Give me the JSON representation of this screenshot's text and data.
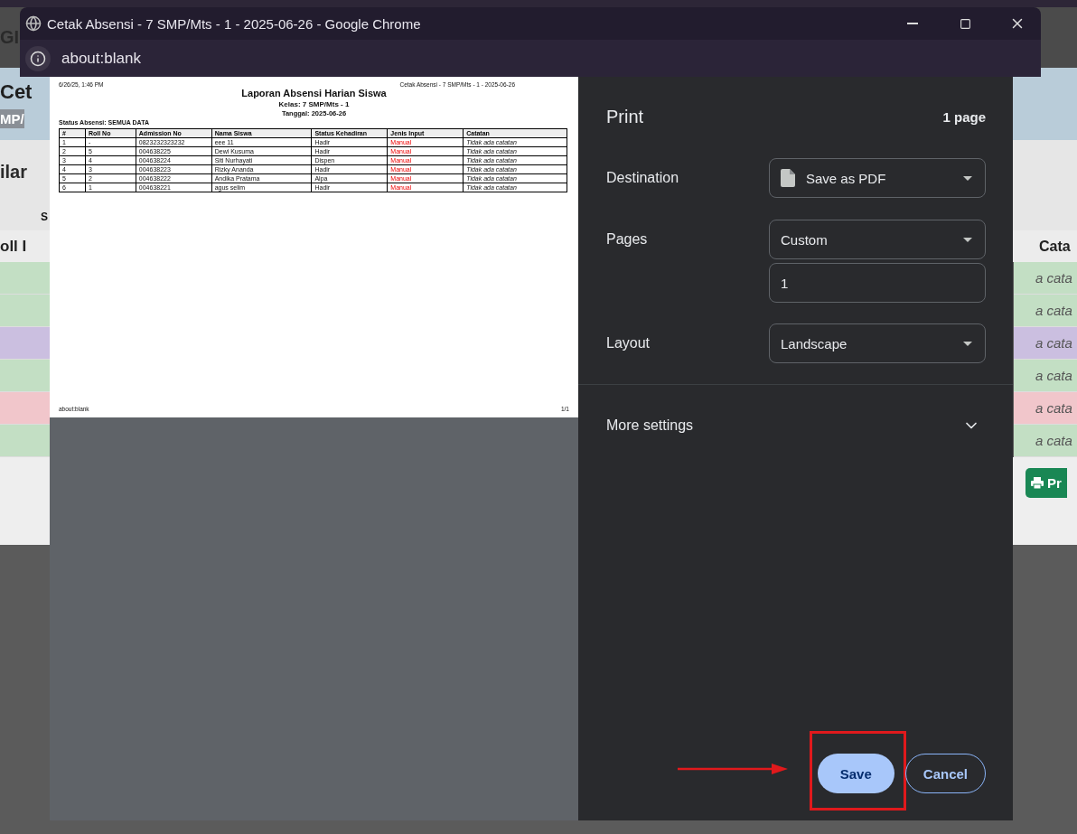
{
  "background_page": {
    "header_title": "GI",
    "banner_title": "Cet",
    "banner_badge": "MP/",
    "section_heading": "ilar",
    "subheading": "S",
    "table": {
      "columns": [
        "oll I",
        "Cata"
      ],
      "rows": [
        {
          "color": "#c3dfc4",
          "note": "a cata"
        },
        {
          "color": "#c3dfc4",
          "note": "a cata"
        },
        {
          "color": "#cbbfe0",
          "note": "a cata"
        },
        {
          "color": "#c3dfc4",
          "note": "a cata"
        },
        {
          "color": "#f1c6cb",
          "note": "a cata"
        },
        {
          "color": "#c3dfc4",
          "note": "a cata"
        }
      ]
    },
    "print_button": "Pr"
  },
  "window": {
    "title": "Cetak Absensi - 7 SMP/Mts - 1 - 2025-06-26 - Google Chrome",
    "address": "about:blank"
  },
  "preview": {
    "timestamp": "6/26/25, 1:46 PM",
    "doc_title": "Cetak Absensi - 7 SMP/Mts - 1 - 2025-06-26",
    "heading": "Laporan Absensi Harian Siswa",
    "class_line": "Kelas: 7 SMP/Mts - 1",
    "date_line": "Tanggal: 2025-06-26",
    "filter_line": "Status Absensi: SEMUA DATA",
    "columns": [
      "#",
      "Roll No",
      "Admission No",
      "Nama Siswa",
      "Status Kehadiran",
      "Jenis Input",
      "Catatan"
    ],
    "rows": [
      [
        "1",
        "-",
        "0823232323232",
        "eee 11",
        "Hadir",
        "Manual",
        "Tidak ada catatan"
      ],
      [
        "2",
        "5",
        "004638225",
        "Dewi Kusuma",
        "Hadir",
        "Manual",
        "Tidak ada catatan"
      ],
      [
        "3",
        "4",
        "004638224",
        "Siti Nurhayati",
        "Dispen",
        "Manual",
        "Tidak ada catatan"
      ],
      [
        "4",
        "3",
        "004638223",
        "Rizky Ananda",
        "Hadir",
        "Manual",
        "Tidak ada catatan"
      ],
      [
        "5",
        "2",
        "004638222",
        "Andika Pratama",
        "Alpa",
        "Manual",
        "Tidak ada catatan"
      ],
      [
        "6",
        "1",
        "004638221",
        "agus selim",
        "Hadir",
        "Manual",
        "Tidak ada catatan"
      ]
    ],
    "footer_left": "about:blank",
    "footer_right": "1/1"
  },
  "print_panel": {
    "title": "Print",
    "page_count": "1 page",
    "settings": [
      {
        "label": "Destination",
        "controls": [
          {
            "kind": "select",
            "value": "Save as PDF",
            "with_icon": true
          }
        ]
      },
      {
        "label": "Pages",
        "controls": [
          {
            "kind": "select",
            "value": "Custom",
            "with_icon": false
          },
          {
            "kind": "input",
            "value": "1"
          }
        ]
      },
      {
        "label": "Layout",
        "controls": [
          {
            "kind": "select",
            "value": "Landscape",
            "with_icon": false
          }
        ]
      }
    ],
    "more_settings": {
      "label": "More settings",
      "expanded": false
    },
    "buttons": [
      {
        "kind": "primary",
        "label": "Save"
      },
      {
        "kind": "secondary",
        "label": "Cancel"
      }
    ]
  }
}
